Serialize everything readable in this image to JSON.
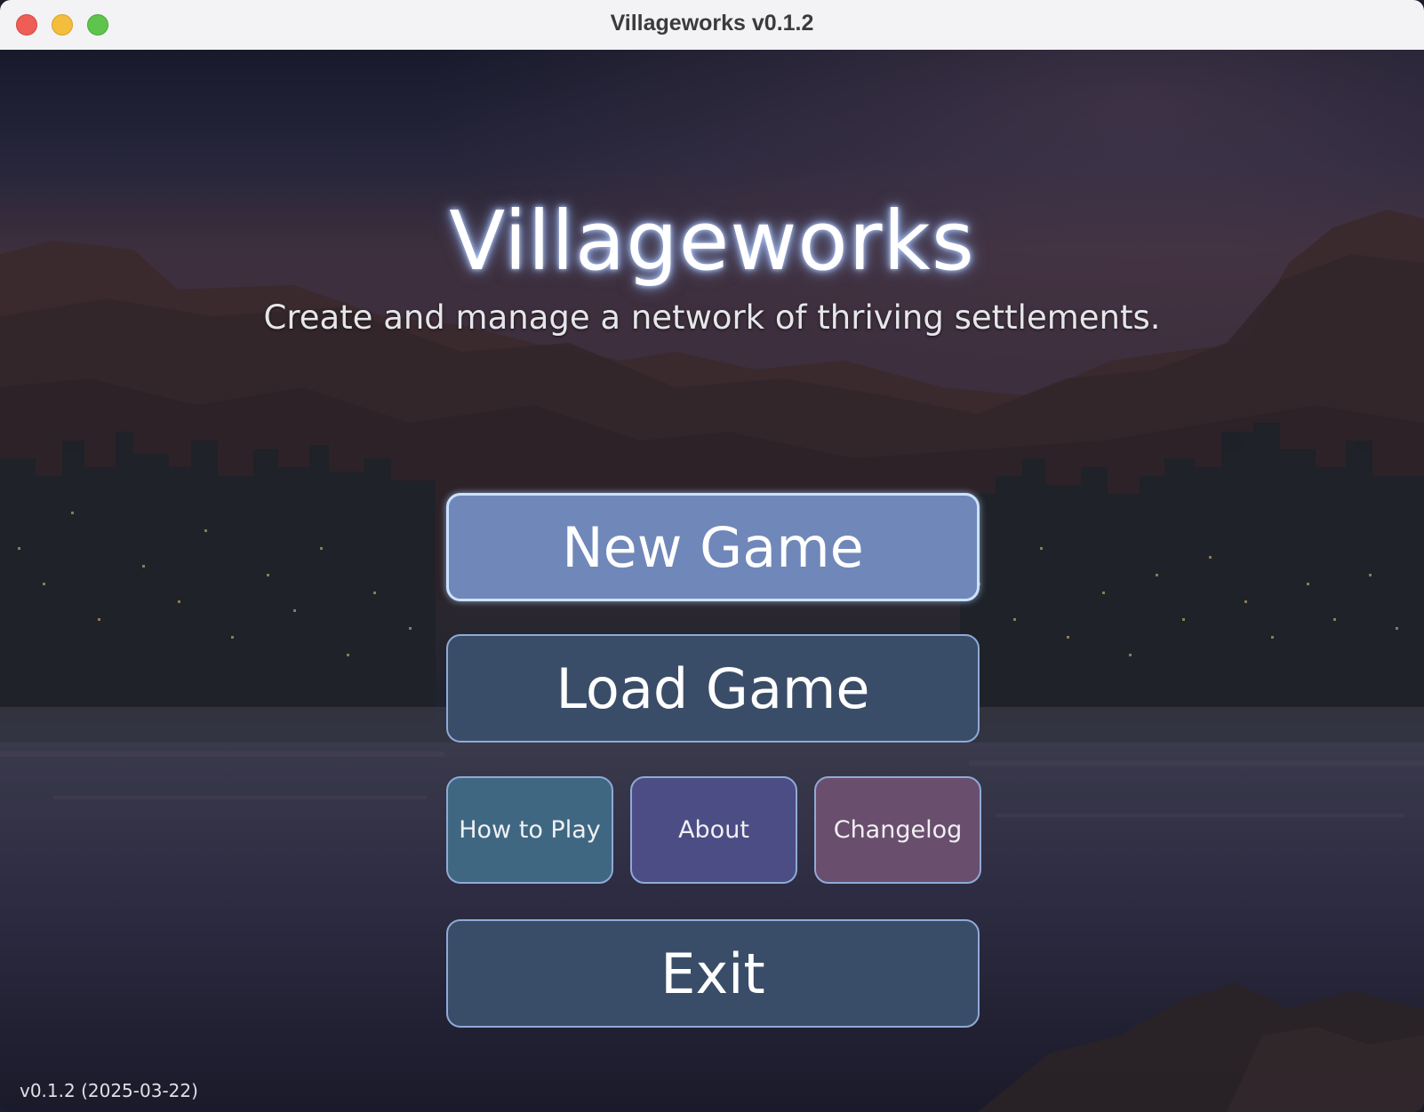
{
  "window": {
    "title": "Villageworks v0.1.2"
  },
  "menu": {
    "title": "Villageworks",
    "subtitle": "Create and manage a network of thriving settlements.",
    "new_game": "New Game",
    "load_game": "Load Game",
    "how_to_play": "How to Play",
    "about": "About",
    "changelog": "Changelog",
    "exit": "Exit"
  },
  "footer": {
    "version": "v0.1.2 (2025-03-22)"
  },
  "colors": {
    "new_game_bg": "#7087b9",
    "load_exit_bg": "#3a4d68",
    "how_to_play_bg": "#3f6782",
    "about_bg": "#4c4d84",
    "changelog_bg": "#6a4e6d",
    "button_border": "#8faad8"
  },
  "icons": {
    "traffic_close": "close-icon",
    "traffic_minimize": "minimize-icon",
    "traffic_maximize": "maximize-icon"
  }
}
